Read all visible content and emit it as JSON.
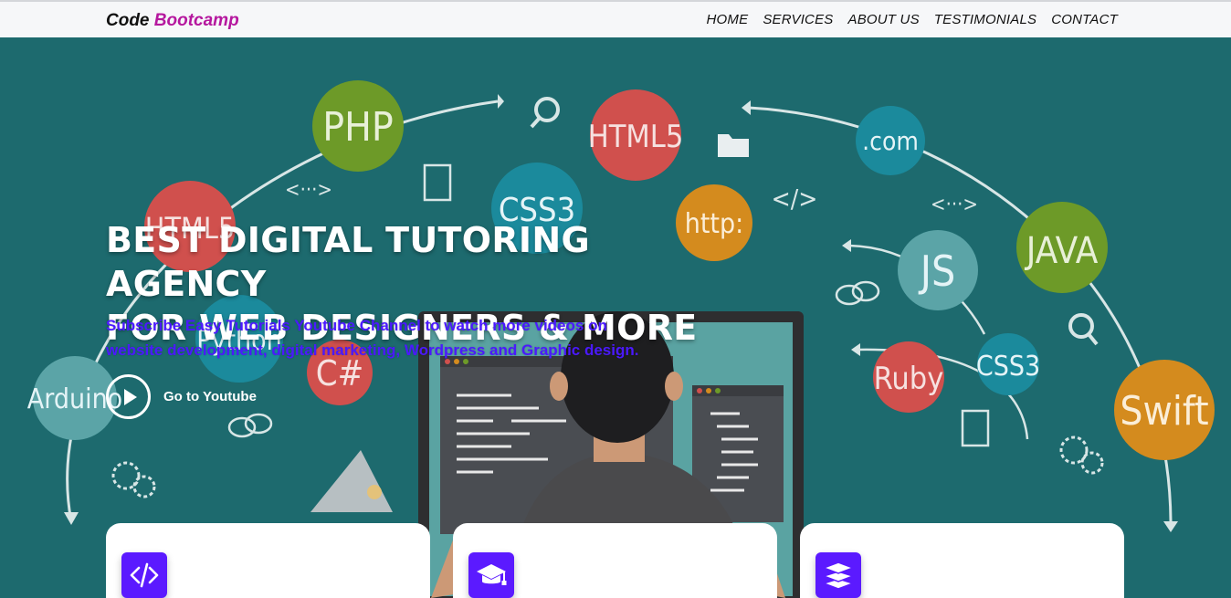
{
  "brand": {
    "part1": "Code",
    "part2": "Bootcamp"
  },
  "nav": {
    "items": [
      "HOME",
      "SERVICES",
      "ABOUT US",
      "TESTIMONIALS",
      "CONTACT"
    ]
  },
  "hero": {
    "title_line1": "BEST DIGITAL TUTORING AGENCY",
    "title_line2": "FOR WEB DESIGNERS & MORE",
    "subtitle_line1": "Subscribe Easy Tutorials Youtube Channel to watch more videos on",
    "subtitle_line2": "website development, digital marketing, Wordpress and Graphic design.",
    "cta_label": "Go to Youtube"
  },
  "background_badges": [
    "PHP",
    "HTML5",
    ".com",
    "CSS3",
    "http:",
    "HTML5",
    "JAVA",
    "JS",
    "Python",
    "C#",
    "Ruby",
    "CSS3",
    "Swift",
    "Arduino",
    "<···>",
    "</>",
    "<···>"
  ],
  "cards": [
    {
      "icon": "code-icon"
    },
    {
      "icon": "graduation-cap-icon"
    },
    {
      "icon": "layers-icon"
    }
  ],
  "colors": {
    "accent": "#b5179e",
    "icon_bg": "#5b1aff",
    "hero_bg": "#1d6a6e",
    "subtitle": "#4b19ff"
  }
}
